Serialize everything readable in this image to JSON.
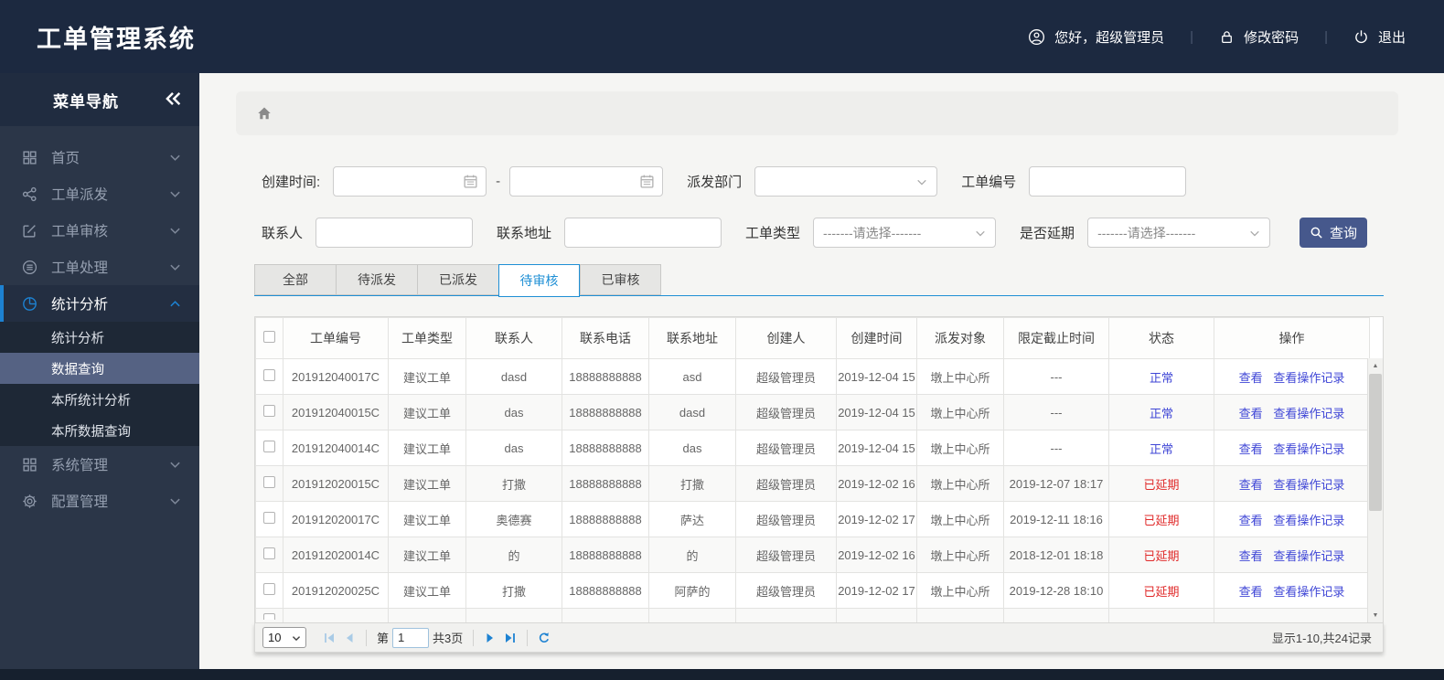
{
  "header": {
    "title": "工单管理系统",
    "greeting": "您好，超级管理员",
    "change_password": "修改密码",
    "logout": "退出",
    "separator": "|"
  },
  "sidebar": {
    "title": "菜单导航",
    "items": [
      {
        "label": "首页",
        "icon": "grid-icon"
      },
      {
        "label": "工单派发",
        "icon": "share-icon"
      },
      {
        "label": "工单审核",
        "icon": "edit-icon"
      },
      {
        "label": "工单处理",
        "icon": "stack-circle-icon"
      },
      {
        "label": "统计分析",
        "icon": "pie-chart-icon",
        "active": true,
        "children": [
          "统计分析",
          "数据查询",
          "本所统计分析",
          "本所数据查询"
        ],
        "selected_child": "数据查询"
      },
      {
        "label": "系统管理",
        "icon": "squares-icon"
      },
      {
        "label": "配置管理",
        "icon": "gear-icon"
      }
    ]
  },
  "filters": {
    "create_time_label": "创建时间:",
    "range_separator": "-",
    "dispatch_dept_label": "派发部门",
    "order_no_label": "工单编号",
    "contact_label": "联系人",
    "address_label": "联系地址",
    "order_type_label": "工单类型",
    "order_type_value": "-------请选择-------",
    "delay_label": "是否延期",
    "delay_value": "-------请选择-------",
    "search_button": "查询"
  },
  "tabs": [
    {
      "label": "全部"
    },
    {
      "label": "待派发"
    },
    {
      "label": "已派发"
    },
    {
      "label": "待审核",
      "active": true
    },
    {
      "label": "已审核"
    }
  ],
  "table": {
    "columns": [
      "工单编号",
      "工单类型",
      "联系人",
      "联系电话",
      "联系地址",
      "创建人",
      "创建时间",
      "派发对象",
      "限定截止时间",
      "状态",
      "操作"
    ],
    "action_labels": [
      "查看",
      "查看操作记录"
    ],
    "rows": [
      {
        "order_no": "201912040017C",
        "type": "建议工单",
        "contact": "dasd",
        "phone": "18888888888",
        "address": "asd",
        "creator": "超级管理员",
        "created": "2019-12-04 15",
        "target": "墩上中心所",
        "deadline": "---",
        "status": "正常",
        "status_type": "normal"
      },
      {
        "order_no": "201912040015C",
        "type": "建议工单",
        "contact": "das",
        "phone": "18888888888",
        "address": "dasd",
        "creator": "超级管理员",
        "created": "2019-12-04 15",
        "target": "墩上中心所",
        "deadline": "---",
        "status": "正常",
        "status_type": "normal"
      },
      {
        "order_no": "201912040014C",
        "type": "建议工单",
        "contact": "das",
        "phone": "18888888888",
        "address": "das",
        "creator": "超级管理员",
        "created": "2019-12-04 15",
        "target": "墩上中心所",
        "deadline": "---",
        "status": "正常",
        "status_type": "normal"
      },
      {
        "order_no": "201912020015C",
        "type": "建议工单",
        "contact": "打撒",
        "phone": "18888888888",
        "address": "打撒",
        "creator": "超级管理员",
        "created": "2019-12-02 16",
        "target": "墩上中心所",
        "deadline": "2019-12-07 18:17",
        "status": "已延期",
        "status_type": "delayed"
      },
      {
        "order_no": "201912020017C",
        "type": "建议工单",
        "contact": "奥德赛",
        "phone": "18888888888",
        "address": "萨达",
        "creator": "超级管理员",
        "created": "2019-12-02 17",
        "target": "墩上中心所",
        "deadline": "2019-12-11 18:16",
        "status": "已延期",
        "status_type": "delayed"
      },
      {
        "order_no": "201912020014C",
        "type": "建议工单",
        "contact": "的",
        "phone": "18888888888",
        "address": "的",
        "creator": "超级管理员",
        "created": "2019-12-02 16",
        "target": "墩上中心所",
        "deadline": "2018-12-01 18:18",
        "status": "已延期",
        "status_type": "delayed"
      },
      {
        "order_no": "201912020025C",
        "type": "建议工单",
        "contact": "打撒",
        "phone": "18888888888",
        "address": "阿萨的",
        "creator": "超级管理员",
        "created": "2019-12-02 17",
        "target": "墩上中心所",
        "deadline": "2019-12-28 18:10",
        "status": "已延期",
        "status_type": "delayed"
      }
    ]
  },
  "pagination": {
    "page_size": "10",
    "page_prefix": "第",
    "current_page": "1",
    "total_pages": "共3页",
    "summary": "显示1-10,共24记录"
  },
  "icons": {
    "user": "user-icon",
    "lock": "lock-icon",
    "power": "power-icon",
    "collapse": "double-chevron-left-icon",
    "home": "home-icon",
    "calendar": "calendar-icon",
    "select_caret": "chevron-down-icon",
    "search": "search-icon",
    "first": "first-page-icon",
    "prev": "prev-page-icon",
    "next": "next-page-icon",
    "last": "last-page-icon",
    "refresh": "refresh-icon",
    "scroll_up": "scroll-up-icon",
    "scroll_down": "scroll-down-icon"
  },
  "colors": {
    "header_bg": "#1c2940",
    "sidebar_bg": "#2b3648",
    "footer_bg": "#16202e",
    "accent_blue": "#1d82d2",
    "tab_active": "#1e8fd5",
    "status_normal": "#3f46d6",
    "status_delayed": "#e02a2a",
    "link": "#3f46d6",
    "search_button_bg": "#46588c",
    "selected_menu_bg": "#556283"
  }
}
